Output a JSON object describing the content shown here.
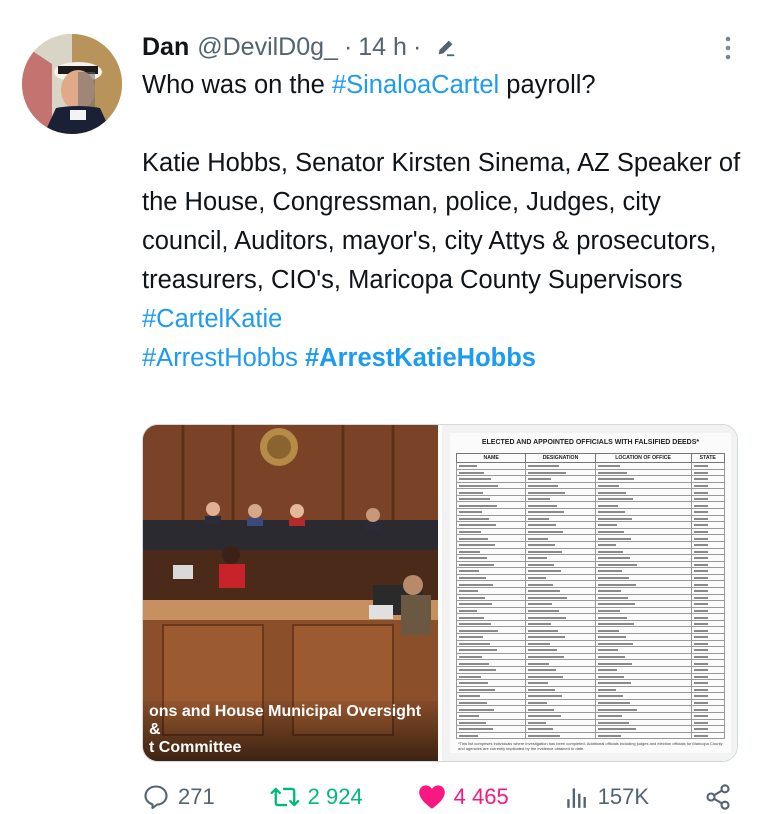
{
  "author": {
    "name": "Dan",
    "handle": "@DevilD0g_",
    "separator": "·",
    "time": "14 h",
    "separator2": "·"
  },
  "tweet": {
    "line1_prefix": "Who was on the ",
    "line1_hashtag": "#SinaloaCartel",
    "line1_suffix": " payroll?",
    "body": "Katie Hobbs, Senator Kirsten Sinema, AZ Speaker of the House, Congressman, police, Judges, city council, Auditors, mayor's, city Attys & prosecutors, treasurers, CIO's, Maricopa County Supervisors",
    "hashtag1": "#CartelKatie",
    "hashtag2": "#ArrestHobbs",
    "hashtag3": "#ArrestKatieHobbs"
  },
  "media": {
    "video_caption_line1": "ons and House Municipal Oversight &",
    "video_caption_line2": "t Committee",
    "doc_title": "ELECTED AND APPOINTED OFFICIALS WITH FALSIFIED DEEDS*",
    "doc_headers": [
      "NAME",
      "DESIGNATION",
      "LOCATION OF OFFICE",
      "STATE"
    ],
    "doc_footnote": "*This list comprises individuals where investigation has been completed. Additional officials including judges and election officials for Maricopa County and agencies are currently implicated by the evidence obtained to date."
  },
  "actions": {
    "reply_count": "271",
    "retweet_count": "2 924",
    "like_count": "4 465",
    "views_count": "157K"
  },
  "colors": {
    "link": "#1d9bf0",
    "retweet": "#00ba7c",
    "like": "#f91880",
    "muted": "#536471"
  },
  "icons": [
    "pencil-icon",
    "more-dots-icon",
    "reply-icon",
    "retweet-icon",
    "heart-icon",
    "views-icon",
    "share-icon"
  ]
}
